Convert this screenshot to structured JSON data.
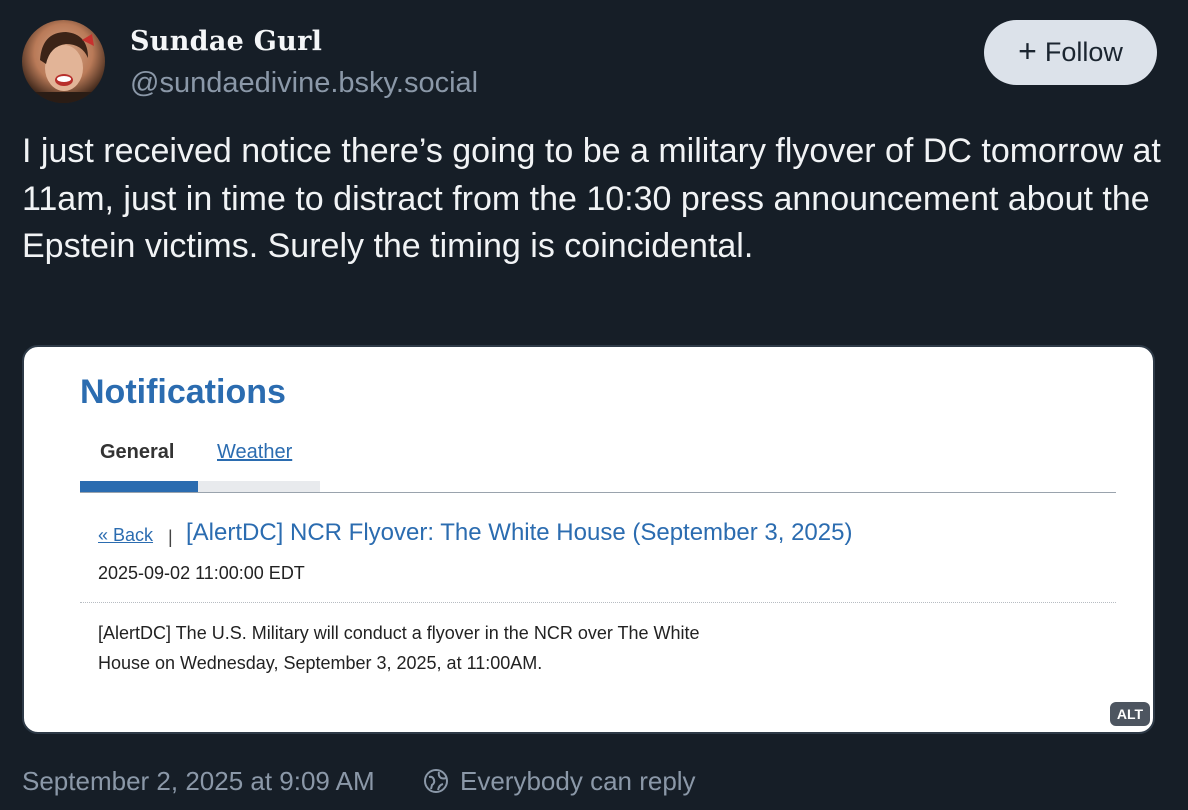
{
  "author": {
    "display_name": "Sundae Gurl",
    "handle": "@sundaedivine.bsky.social"
  },
  "follow_button": {
    "icon": "plus-icon",
    "label": "Follow"
  },
  "post": {
    "text": "I just received notice there’s going to be a military flyover of DC tomorrow at 11am, just in time to distract from the 10:30 press announcement about the Epstein victims. Surely the timing is coincidental."
  },
  "embed": {
    "heading": "Notifications",
    "tabs": [
      "General",
      "Weather"
    ],
    "active_tab": "General",
    "back_label": "« Back",
    "separator": "|",
    "alert_title": "[AlertDC] NCR Flyover: The White House (September 3, 2025)",
    "alert_datetime": "2025-09-02 11:00:00 EDT",
    "alert_body_line1": "[AlertDC] The U.S. Military will conduct a flyover in the NCR over The White",
    "alert_body_line2": "House on Wednesday, September 3, 2025, at 11:00AM.",
    "alt_badge": "ALT"
  },
  "footer": {
    "timestamp": "September 2, 2025 at 9:09 AM",
    "reply_icon": "globe-icon",
    "reply_setting": "Everybody can reply"
  },
  "colors": {
    "background": "#161e27",
    "accent_blue": "#2b6cb0",
    "muted_text": "#8b98a8",
    "follow_button_bg": "#dce2ea"
  }
}
